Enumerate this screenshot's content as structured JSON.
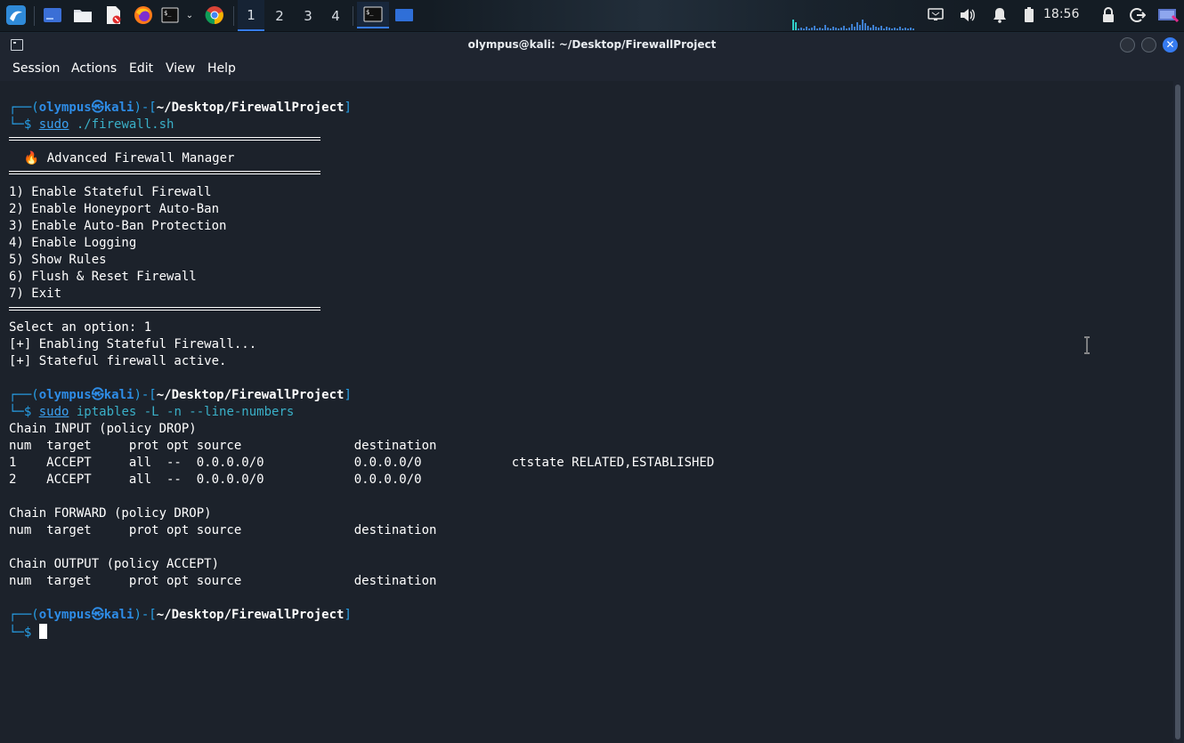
{
  "taskbar": {
    "workspaces": [
      "1",
      "2",
      "3",
      "4"
    ],
    "clock": "18:56",
    "icons": [
      "kali-menu-icon",
      "desktop-icon",
      "file-manager-icon",
      "text-editor-icon",
      "firefox-icon",
      "terminal-icon",
      "chevron-down-icon",
      "chrome-icon",
      "terminal-window-icon",
      "window-icon",
      "network-icon",
      "volume-icon",
      "notification-icon",
      "battery-icon",
      "lock-icon",
      "logout-icon",
      "screenshot-icon"
    ]
  },
  "window": {
    "title": "olympus@kali: ~/Desktop/FirewallProject",
    "menu": [
      "Session",
      "Actions",
      "Edit",
      "View",
      "Help"
    ]
  },
  "terminal": {
    "prompt": {
      "user": "olympus",
      "host": "kali",
      "path": "~/Desktop/FirewallProject",
      "open": "┌──(",
      "sep": "㉿",
      "mid": ")-[",
      "close": "]",
      "dollar": "└─$ "
    },
    "cmd1": {
      "sudo": "sudo",
      "rest": " ./firewall.sh"
    },
    "banner": "  🔥 Advanced Firewall Manager",
    "options": [
      "1) Enable Stateful Firewall",
      "2) Enable Honeyport Auto-Ban",
      "3) Enable Auto-Ban Protection",
      "4) Enable Logging",
      "5) Show Rules",
      "6) Flush & Reset Firewall",
      "7) Exit"
    ],
    "select": "Select an option: 1",
    "out1": "[+] Enabling Stateful Firewall...",
    "out2": "[+] Stateful firewall active.",
    "cmd2": {
      "sudo": "sudo",
      "rest": " iptables -L -n --line-numbers"
    },
    "iptables": [
      "Chain INPUT (policy DROP)",
      "num  target     prot opt source               destination",
      "1    ACCEPT     all  --  0.0.0.0/0            0.0.0.0/0            ctstate RELATED,ESTABLISHED",
      "2    ACCEPT     all  --  0.0.0.0/0            0.0.0.0/0",
      "",
      "Chain FORWARD (policy DROP)",
      "num  target     prot opt source               destination",
      "",
      "Chain OUTPUT (policy ACCEPT)",
      "num  target     prot opt source               destination"
    ]
  }
}
